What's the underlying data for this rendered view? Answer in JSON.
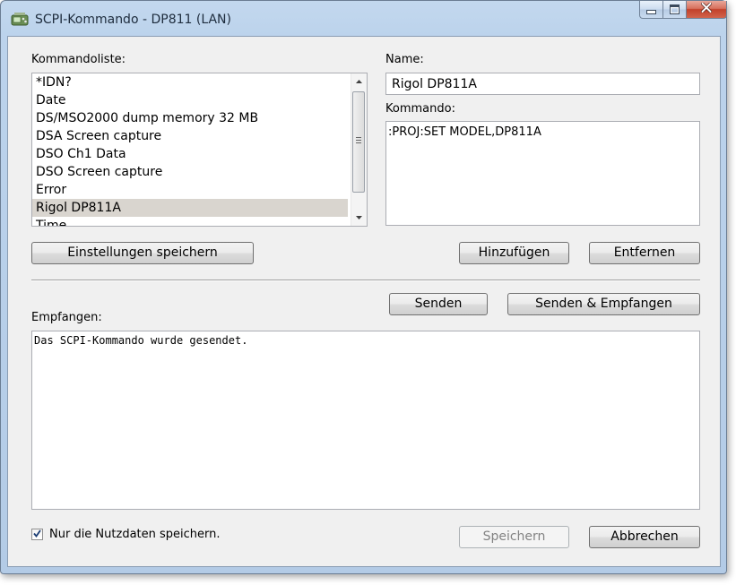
{
  "window": {
    "title": "SCPI-Kommando - DP811 (LAN)",
    "app_icon": "instrument-icon",
    "caption_buttons": [
      "minimize-icon",
      "maximize-icon",
      "close-icon"
    ]
  },
  "commands": {
    "label": "Kommandoliste:",
    "items": [
      "*IDN?",
      "Date",
      "DS/MSO2000 dump memory 32 MB",
      "DSA Screen capture",
      "DSO Ch1 Data",
      "DSO Screen capture",
      "Error",
      "Rigol DP811A",
      "Time"
    ],
    "selected": "Rigol DP811A"
  },
  "name": {
    "label": "Name:",
    "value": "Rigol DP811A"
  },
  "command": {
    "label": "Kommando:",
    "value": ":PROJ:SET MODEL,DP811A"
  },
  "buttons": {
    "save_settings": "Einstellungen speichern",
    "add": "Hinzufügen",
    "remove": "Entfernen",
    "send": "Senden",
    "send_receive": "Senden & Empfangen",
    "save": "Speichern",
    "cancel": "Abbrechen"
  },
  "received": {
    "label": "Empfangen:",
    "text": "Das SCPI-Kommando wurde gesendet."
  },
  "payload_only": {
    "label": "Nur die Nutzdaten speichern.",
    "checked": true
  },
  "colors": {
    "selection": "#d9d5cf",
    "title_bar": "#bcd3ec",
    "close_button": "#c2402a"
  }
}
